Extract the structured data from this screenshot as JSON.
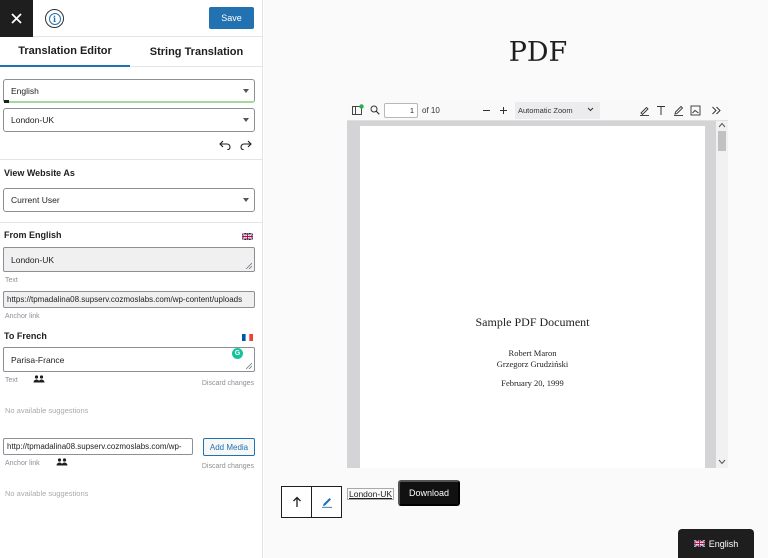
{
  "header": {
    "save_label": "Save",
    "close_icon": "close-icon",
    "info_icon": "info-icon"
  },
  "tabs": [
    {
      "label": "Translation Editor",
      "active": true
    },
    {
      "label": "String Translation",
      "active": false
    }
  ],
  "language_select": {
    "value": "English"
  },
  "string_select": {
    "value": "London-UK"
  },
  "view_as": {
    "title": "View Website As",
    "value": "Current User"
  },
  "from": {
    "title": "From English",
    "text_value": "London-UK",
    "text_label": "Text",
    "link_value": "https://tpmadalina08.supserv.cozmoslabs.com/wp-content/uploads",
    "link_label": "Anchor link"
  },
  "to": {
    "title": "To French",
    "text_value": "Parisa-France",
    "text_label": "Text",
    "discard_label": "Discard changes",
    "suggestions": "No available suggestions",
    "link_value": "http://tpmadalina08.supserv.cozmoslabs.com/wp-",
    "add_media_label": "Add Media",
    "link_label": "Anchor link",
    "discard_label_2": "Discard changes",
    "suggestions_2": "No available suggestions"
  },
  "preview": {
    "page_title": "PDF",
    "viewer": {
      "page_number": "1",
      "page_total": "of 10",
      "zoom": "Automatic Zoom",
      "doc_title": "Sample PDF Document",
      "author_1": "Robert Maron",
      "author_2": "Grzegorz Grudziński",
      "date": "February 20, 1999"
    },
    "locale_link": "London-UK",
    "download_label": "Download",
    "language_switcher": "English"
  },
  "colors": {
    "accent": "#2271b1",
    "dark": "#1e1e1e"
  }
}
